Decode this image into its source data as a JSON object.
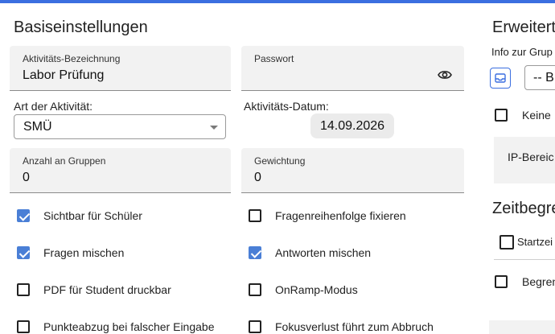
{
  "left": {
    "heading": "Basiseinstellungen",
    "activity_name": {
      "label": "Aktivitäts-Bezeichnung",
      "value": "Labor Prüfung"
    },
    "password": {
      "label": "Passwort",
      "value": ""
    },
    "activity_type": {
      "label": "Art der Aktivität:",
      "value": "SMÜ"
    },
    "activity_date": {
      "label": "Aktivitäts-Datum:",
      "value": "14.09.2026"
    },
    "group_count": {
      "label": "Anzahl an Gruppen",
      "value": "0"
    },
    "weighting": {
      "label": "Gewichtung",
      "value": "0"
    },
    "checkboxes": [
      {
        "label": "Sichtbar für Schüler",
        "checked": true
      },
      {
        "label": "Fragenreihenfolge fixieren",
        "checked": false
      },
      {
        "label": "Fragen mischen",
        "checked": true
      },
      {
        "label": "Antworten mischen",
        "checked": true
      },
      {
        "label": "PDF für Student druckbar",
        "checked": false
      },
      {
        "label": "OnRamp-Modus",
        "checked": false
      },
      {
        "label": "Punkteabzug bei falscher Eingabe",
        "checked": false
      },
      {
        "label": "Fokusverlust führt zum Abbruch",
        "checked": false
      }
    ]
  },
  "right": {
    "heading": "Erweitert",
    "group_info_label": "Info zur Grup",
    "group_select_value": "-- B",
    "no_label": "Keine I",
    "ip_label": "IP-Bereic",
    "time_heading": "Zeitbegre",
    "start_label": "Startzei",
    "limit_label": "Begren"
  },
  "icons": {
    "password_toggle": "eye-icon",
    "group_info": "inbox-icon",
    "select_caret": "chevron-down-icon"
  },
  "colors": {
    "accent": "#3b6fe0",
    "checkbox_checked": "#4a7fd6"
  }
}
